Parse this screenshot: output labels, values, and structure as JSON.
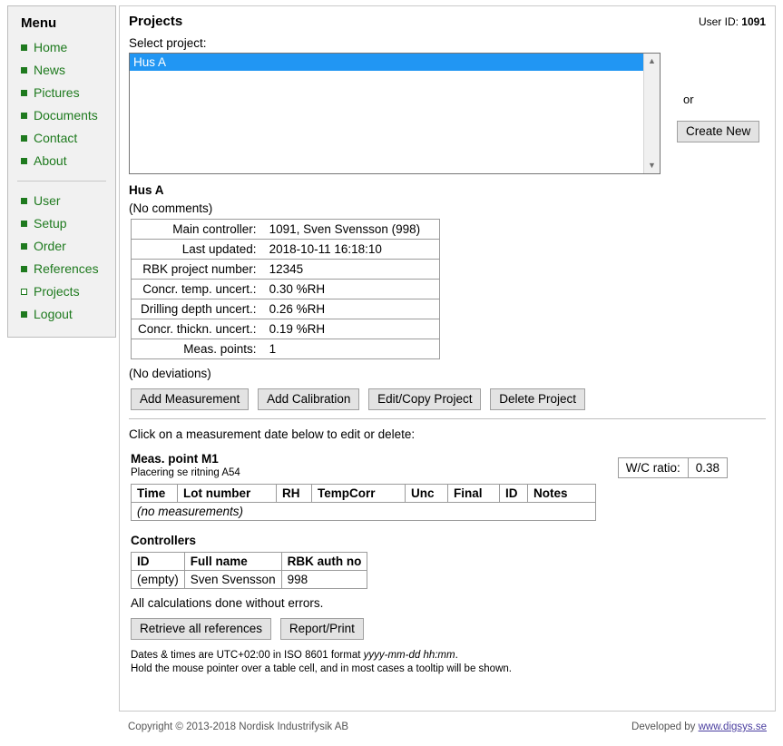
{
  "sidebar": {
    "title": "Menu",
    "group1": [
      {
        "label": "Home",
        "bullet": "filled-square-icon"
      },
      {
        "label": "News",
        "bullet": "filled-square-icon"
      },
      {
        "label": "Pictures",
        "bullet": "filled-square-icon"
      },
      {
        "label": "Documents",
        "bullet": "filled-square-icon"
      },
      {
        "label": "Contact",
        "bullet": "filled-square-icon"
      },
      {
        "label": "About",
        "bullet": "filled-square-icon"
      }
    ],
    "group2": [
      {
        "label": "User",
        "bullet": "filled-square-icon"
      },
      {
        "label": "Setup",
        "bullet": "filled-square-icon"
      },
      {
        "label": "Order",
        "bullet": "filled-square-icon"
      },
      {
        "label": "References",
        "bullet": "filled-square-icon"
      },
      {
        "label": "Projects",
        "bullet": "hollow-square-icon"
      },
      {
        "label": "Logout",
        "bullet": "filled-square-icon"
      }
    ],
    "accent_color": "#1e7a1e"
  },
  "header": {
    "title": "Projects",
    "user_id_label": "User ID:",
    "user_id_value": "1091"
  },
  "project_select": {
    "label": "Select project:",
    "options": [
      "Hus A"
    ],
    "selected": "Hus A",
    "selected_color": "#2196f3",
    "scroll_up_icon": "chevron-up-icon",
    "scroll_down_icon": "chevron-down-icon",
    "or_text": "or",
    "create_new_label": "Create New"
  },
  "project": {
    "name": "Hus A",
    "comments": "(No comments)",
    "deviations": "(No deviations)",
    "info_rows": [
      {
        "key": "Main controller:",
        "value": "1091, Sven Svensson (998)"
      },
      {
        "key": "Last updated:",
        "value": "2018-10-11 16:18:10"
      },
      {
        "key": "RBK project number:",
        "value": "12345"
      },
      {
        "key": "Concr. temp. uncert.:",
        "value": "0.30 %RH"
      },
      {
        "key": "Drilling depth uncert.:",
        "value": "0.26 %RH"
      },
      {
        "key": "Concr. thickn. uncert.:",
        "value": "0.19 %RH"
      },
      {
        "key": "Meas. points:",
        "value": "1"
      }
    ],
    "actions": [
      "Add Measurement",
      "Add Calibration",
      "Edit/Copy Project",
      "Delete Project"
    ]
  },
  "measurements": {
    "hint": "Click on a measurement date below to edit or delete:",
    "point_title": "Meas. point M1",
    "point_sub": "Placering se ritning A54",
    "wc_label": "W/C ratio:",
    "wc_value": "0.38",
    "columns": {
      "time": "Time",
      "lot_number": "Lot number",
      "rh": "RH",
      "temp": "Temp",
      "corr": "Corr",
      "unc": "Unc",
      "final": "Final",
      "id": "ID",
      "notes": "Notes"
    },
    "empty_text": "(no measurements)"
  },
  "controllers": {
    "title": "Controllers",
    "columns": [
      "ID",
      "Full name",
      "RBK auth no"
    ],
    "rows": [
      {
        "id": "(empty)",
        "full_name": "Sven Svensson",
        "rbk_auth_no": "998"
      }
    ]
  },
  "status": {
    "calc_text": "All calculations done without errors.",
    "buttons": [
      "Retrieve all references",
      "Report/Print"
    ],
    "fineprint_line1_a": "Dates & times are UTC+02:00 in ISO 8601 format ",
    "fineprint_line1_b": "yyyy-mm-dd hh:mm",
    "fineprint_line1_c": ".",
    "fineprint_line2": "Hold the mouse pointer over a table cell, and in most cases a tooltip will be shown."
  },
  "footer": {
    "copyright": "Copyright © 2013-2018 Nordisk Industrifysik AB",
    "developed_by": "Developed by ",
    "developer_link": "www.digsys.se"
  }
}
